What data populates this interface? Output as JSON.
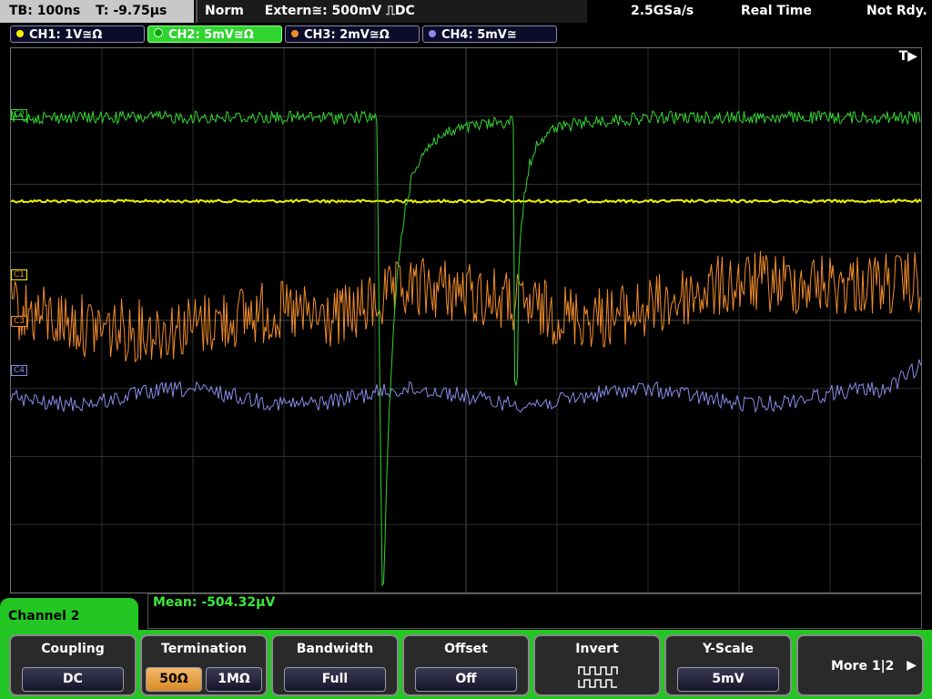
{
  "status": {
    "timebase": "TB: 100ns",
    "trigger_time": "T: -9.75µs",
    "trigger_mode": "Norm",
    "trigger_source": "Extern≅: 500mV ⎍DC",
    "sample_rate": "2.5GSa/s",
    "acq_mode": "Real Time",
    "acq_state": "Not Rdy."
  },
  "channels": [
    {
      "label": "CH1: 1V≅Ω",
      "color": "#f2f200"
    },
    {
      "label": "CH2: 5mV≅Ω",
      "color": "#33d433"
    },
    {
      "label": "CH3: 2mV≅Ω",
      "color": "#f08c2a"
    },
    {
      "label": "CH4: 5mV≅",
      "color": "#8a8ae8"
    }
  ],
  "markers": {
    "trigger": "T▶",
    "c1": "C1",
    "c3": "C3",
    "c4": "C4",
    "c2": "C2"
  },
  "measurement": "Mean: -504.32µV",
  "menu": {
    "title": "Channel 2",
    "coupling": {
      "title": "Coupling",
      "value": "DC"
    },
    "termination": {
      "title": "Termination",
      "opt1": "50Ω",
      "opt2": "1MΩ"
    },
    "bandwidth": {
      "title": "Bandwidth",
      "value": "Full"
    },
    "offset": {
      "title": "Offset",
      "value": "Off"
    },
    "invert": {
      "title": "Invert"
    },
    "yscale": {
      "title": "Y-Scale",
      "value": "5mV"
    },
    "more": "More 1|2"
  }
}
